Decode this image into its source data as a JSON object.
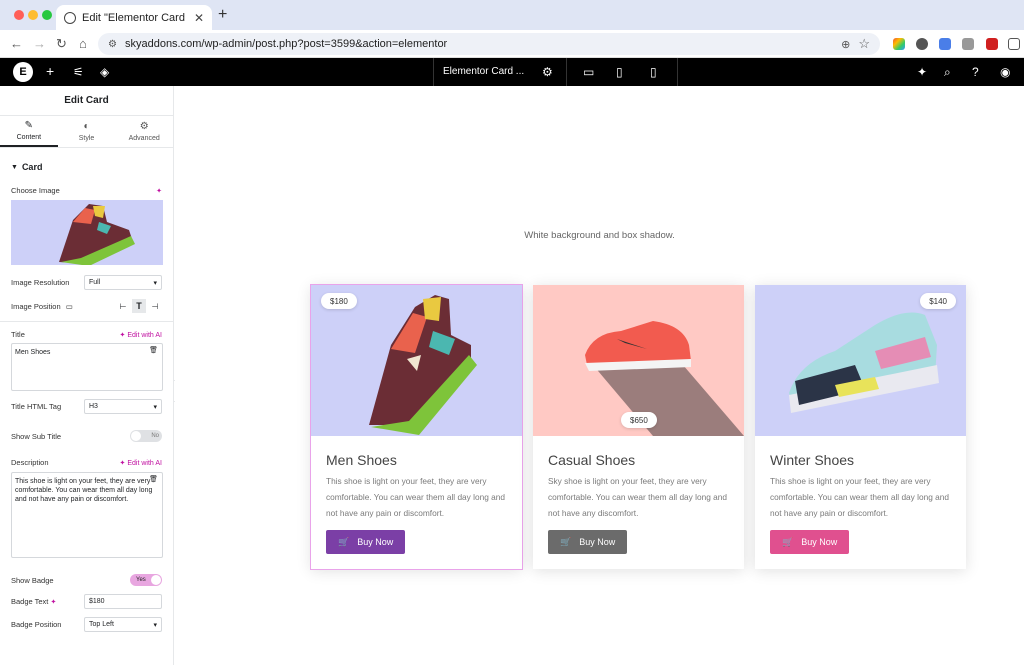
{
  "browser": {
    "tab_title": "Edit \"Elementor Card Widget",
    "url": "skyaddons.com/wp-admin/post.php?post=3599&action=elementor"
  },
  "editor_top": {
    "document_title": "Elementor Card ..."
  },
  "panel": {
    "title": "Edit Card",
    "tabs": [
      {
        "label": "Content",
        "icon": "pencil-icon"
      },
      {
        "label": "Style",
        "icon": "contrast-icon"
      },
      {
        "label": "Advanced",
        "icon": "gear-icon"
      }
    ],
    "section": "Card",
    "choose_image": "Choose Image",
    "image_resolution_label": "Image Resolution",
    "image_resolution_value": "Full",
    "image_position_label": "Image Position",
    "title_label": "Title",
    "edit_with_ai": "Edit with AI",
    "title_value": "Men Shoes",
    "title_tag_label": "Title HTML Tag",
    "title_tag_value": "H3",
    "show_sub_title_label": "Show Sub Title",
    "show_sub_title_value": "No",
    "description_label": "Description",
    "description_value": "This shoe is light on your feet, they are very comfortable. You can wear them all day long and not have any pain or discomfort.",
    "show_badge_label": "Show Badge",
    "show_badge_value": "Yes",
    "badge_text_label": "Badge Text",
    "badge_text_value": "$180",
    "badge_position_label": "Badge Position",
    "badge_position_value": "Top Left"
  },
  "canvas": {
    "subtitle": "White background and box shadow.",
    "cards": [
      {
        "badge": "$180",
        "title": "Men Shoes",
        "desc": "This shoe is light on your feet, they are very comfortable. You can wear them all day long and not have any pain or discomfort.",
        "button": "Buy Now",
        "button_color": "#7b3fa6",
        "bg": "#cdd0f8"
      },
      {
        "badge": "$650",
        "title": "Casual Shoes",
        "desc": "Sky shoe is light on your feet, they are very comfortable. You can wear them all day long and not have any discomfort.",
        "button": "Buy Now",
        "button_color": "#6b6b6b",
        "bg": "#ffc9c4"
      },
      {
        "badge": "$140",
        "title": "Winter Shoes",
        "desc": "This shoe is light on your feet, they are very comfortable. You can wear them all day long and not have any pain or discomfort.",
        "button": "Buy Now",
        "button_color": "#e0508f",
        "bg": "#cdd0f8"
      }
    ]
  }
}
